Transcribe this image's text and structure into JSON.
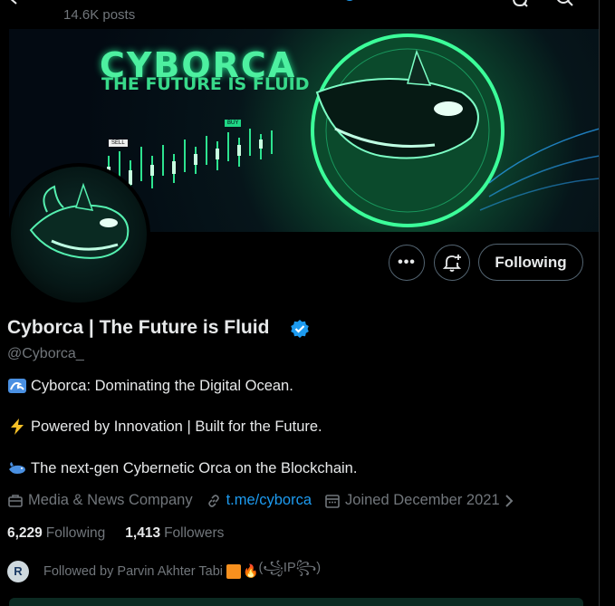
{
  "header": {
    "posts_count": "14.6K posts"
  },
  "banner": {
    "title": "CYBORCA",
    "subtitle": "THE FUTURE IS FLUID",
    "buy_tag": "BUY",
    "sell_tag": "SELL"
  },
  "actions": {
    "more_label": "•••",
    "following_label": "Following"
  },
  "profile": {
    "display_name": "Cyborca | The Future is Fluid",
    "handle": "@Cyborca_",
    "bio": [
      "Cyborca: Dominating the Digital Ocean.",
      "Powered by Innovation | Built for the Future.",
      "The next-gen Cybernetic Orca on the Blockchain."
    ],
    "category": "Media & News Company",
    "link": "t.me/cyborca",
    "joined": "Joined December 2021"
  },
  "stats": {
    "following_count": "6,229",
    "following_label": "Following",
    "followers_count": "1,413",
    "followers_label": "Followers"
  },
  "followed_by": {
    "avatar_letter": "R",
    "text": "Followed by Parvin Akhter Tabi",
    "suffix": "(꧁IP꧂)"
  },
  "colors": {
    "accent": "#1d9bf0",
    "muted": "#71767b",
    "text": "#e7e9ea",
    "border": "#536471",
    "background": "#000000"
  }
}
